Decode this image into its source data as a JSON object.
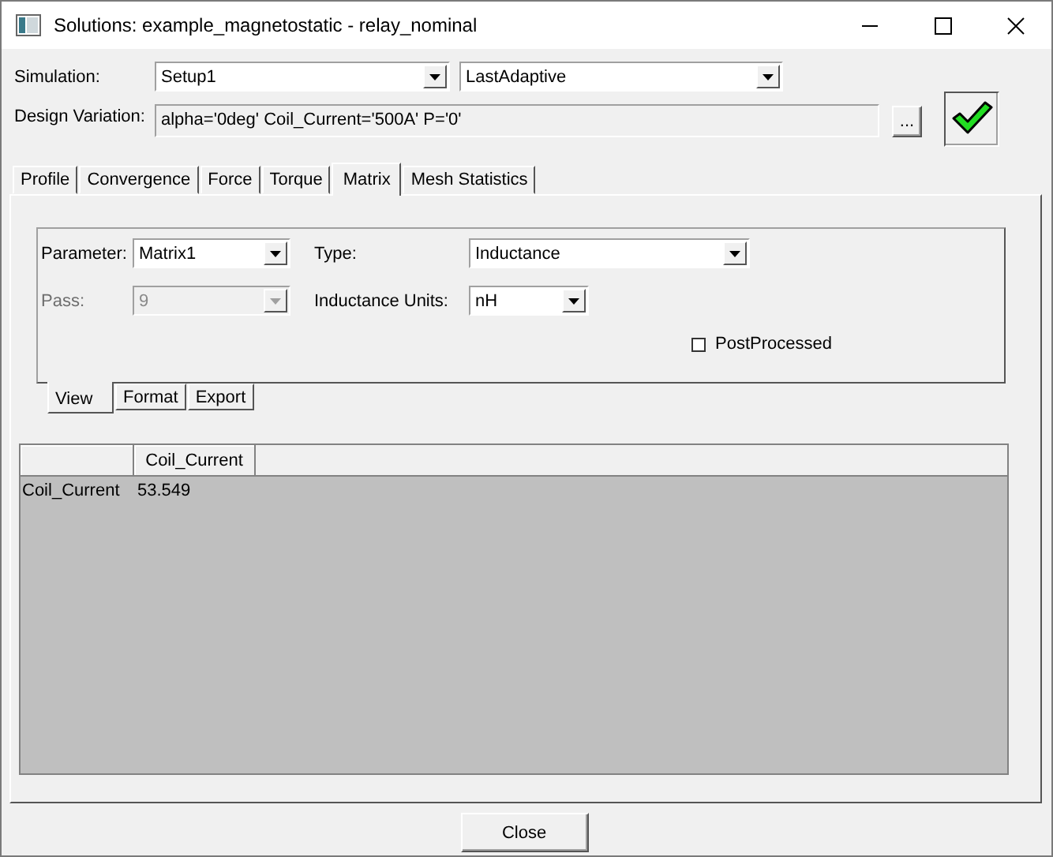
{
  "window": {
    "title": "Solutions: example_magnetostatic - relay_nominal"
  },
  "simulation": {
    "label": "Simulation:",
    "setup": "Setup1",
    "solution": "LastAdaptive"
  },
  "design_variation": {
    "label": "Design Variation:",
    "value": "alpha='0deg' Coil_Current='500A' P='0'",
    "browse_button": "..."
  },
  "tabs": [
    {
      "label": "Profile",
      "selected": false
    },
    {
      "label": "Convergence",
      "selected": false
    },
    {
      "label": "Force",
      "selected": false
    },
    {
      "label": "Torque",
      "selected": false
    },
    {
      "label": "Matrix",
      "selected": true
    },
    {
      "label": "Mesh Statistics",
      "selected": false
    }
  ],
  "matrix_panel": {
    "parameter": {
      "label": "Parameter:",
      "value": "Matrix1",
      "disabled": false
    },
    "pass": {
      "label": "Pass:",
      "value": "9",
      "disabled": true
    },
    "type": {
      "label": "Type:",
      "value": "Inductance",
      "disabled": false
    },
    "units": {
      "label": "Inductance Units:",
      "value": "nH",
      "disabled": false
    },
    "post_processed": {
      "label": "PostProcessed",
      "checked": false
    }
  },
  "view_tabs": [
    {
      "label": "View",
      "selected": true
    },
    {
      "label": "Format",
      "selected": false
    },
    {
      "label": "Export",
      "selected": false
    }
  ],
  "grid": {
    "columns": [
      "Coil_Current"
    ],
    "rows": [
      {
        "header": "Coil_Current",
        "cells": [
          "53.549"
        ]
      }
    ]
  },
  "buttons": [
    "Close"
  ]
}
